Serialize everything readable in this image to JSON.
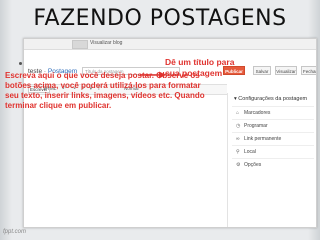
{
  "slide": {
    "title": "FAZENDO POSTAGENS",
    "watermark": "fppt.com"
  },
  "blogger": {
    "top_bar_text": "Visualizar blog",
    "breadcrumb_prefix": "teste",
    "breadcrumb_section": "Postagem",
    "title_placeholder": "Título da postagem",
    "buttons": {
      "publish": "Publicar",
      "save": "Salvar",
      "preview": "Visualizar",
      "close": "Fechar"
    },
    "toolbar": {
      "compose": "Escrever",
      "html": "HTML",
      "format": "Normal"
    },
    "settings": {
      "header": "Configurações da postagem",
      "items": [
        {
          "label": "Marcadores",
          "icon": "tag-icon"
        },
        {
          "label": "Programar",
          "icon": "clock-icon"
        },
        {
          "label": "Link permanente",
          "icon": "link-icon"
        },
        {
          "label": "Local",
          "icon": "location-icon"
        },
        {
          "label": "Opções",
          "icon": "gear-icon"
        }
      ]
    }
  },
  "annotations": {
    "title_callout": "Dê um título para\nsua postagem",
    "editor_instructions": "Escreva  aqui o que você deseja postar. Observe os botões acima, você poderá utilizá-los para formatar seu texto, inserir links, imagens, vídeos etc. Quando terminar clique em publicar."
  },
  "colors": {
    "accent_red": "#e0332f",
    "publish_orange": "#e65a3c",
    "link_blue": "#2a6ab9"
  }
}
